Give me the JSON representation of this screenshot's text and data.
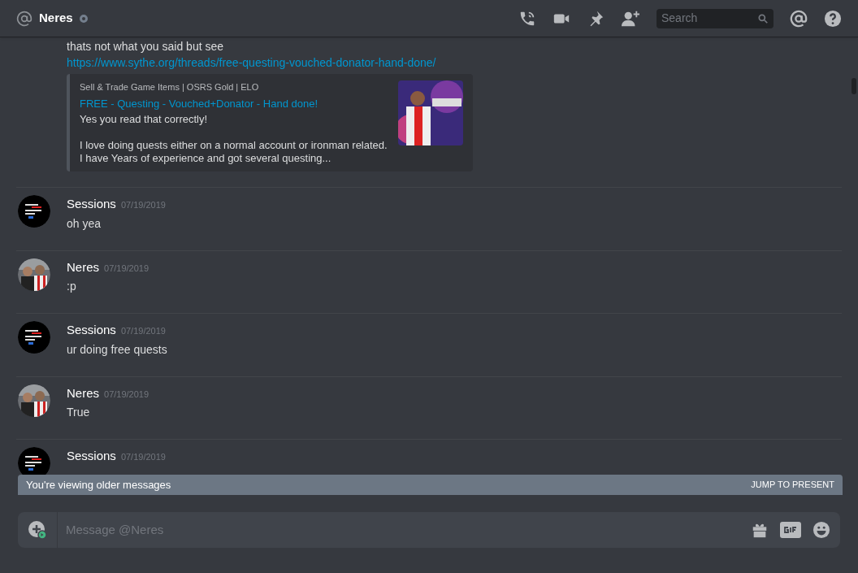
{
  "header": {
    "title": "Neres",
    "search": {
      "placeholder": "Search"
    }
  },
  "continuation": {
    "text": "thats not what you said but see",
    "link": "https://www.sythe.org/threads/free-questing-vouched-donator-hand-done/",
    "embed": {
      "provider": "Sell & Trade Game Items | OSRS Gold | ELO",
      "title": "FREE - Questing - Vouched+Donator - Hand done!",
      "paragraphs": [
        [
          "Yes you read that correctly!"
        ],
        [
          "I love doing quests either on a normal account or ironman related.",
          "I have Years of experience and got several questing..."
        ]
      ]
    }
  },
  "messages": [
    {
      "kind": "logo",
      "author": "Sessions",
      "date": "07/19/2019",
      "text": "oh yea"
    },
    {
      "author": "Neres",
      "date": "07/19/2019",
      "text": ":p"
    },
    {
      "kind": "logo",
      "author": "Sessions",
      "date": "07/19/2019",
      "text": "ur doing free quests"
    },
    {
      "author": "Neres",
      "date": "07/19/2019",
      "text": "True"
    },
    {
      "kind": "logo",
      "author": "Sessions",
      "date": "07/19/2019"
    }
  ],
  "banner": {
    "text": "You're viewing older messages",
    "action": "JUMP TO PRESENT"
  },
  "composer": {
    "placeholder": "Message @Neres"
  }
}
